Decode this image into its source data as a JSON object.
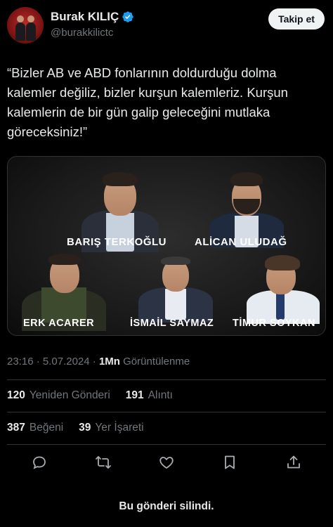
{
  "author": {
    "name": "Burak KILIÇ",
    "handle": "@burakkilictc",
    "verified": true,
    "follow_label": "Takip et"
  },
  "tweet": {
    "text": "“Bizler AB ve ABD fonlarının doldurduğu dolma\nkalemler değiliz, bizler kurşun kalemleriz. Kurşun\nkalemlerin de bir gün galip geleceğini mutlaka\ngöreceksiniz!”"
  },
  "media": {
    "people": [
      "BARIŞ TERKOĞLU",
      "ALİCAN ULUDAĞ",
      "ERK ACARER",
      "İSMAİL SAYMAZ",
      "TİMUR SOYKAN"
    ]
  },
  "meta": {
    "time": "23:16",
    "date": "5.07.2024",
    "views_count": "1Mn",
    "views_label": "Görüntülenme"
  },
  "stats": {
    "reposts_count": "120",
    "reposts_label": "Yeniden Gönderi",
    "quotes_count": "191",
    "quotes_label": "Alıntı",
    "likes_count": "387",
    "likes_label": "Beğeni",
    "bookmarks_count": "39",
    "bookmarks_label": "Yer İşareti"
  },
  "actions": [
    "reply-icon",
    "repost-icon",
    "like-icon",
    "bookmark-icon",
    "share-icon"
  ],
  "footer": {
    "deleted_text": "Bu gönderi silindi."
  },
  "colors": {
    "background": "#000000",
    "text": "#e7e9ea",
    "muted": "#71767b",
    "verified": "#1d9bf0",
    "divider": "#2f3336"
  }
}
